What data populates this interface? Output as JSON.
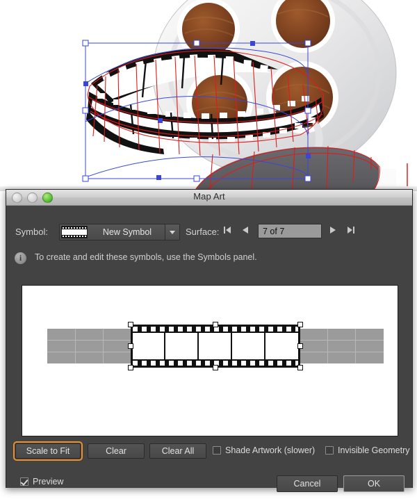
{
  "window": {
    "title": "Map Art",
    "traffic_lights": [
      {
        "name": "close-button",
        "state": "disabled"
      },
      {
        "name": "minimize-button",
        "state": "disabled"
      },
      {
        "name": "zoom-button",
        "state": "enabled",
        "color": "#59c13a"
      }
    ]
  },
  "symbol_row": {
    "label": "Symbol:",
    "selected": "New Symbol",
    "thumbnail_icon": "film-strip-icon",
    "dropdown_icon": "chevron-down-icon"
  },
  "surface_row": {
    "label": "Surface:",
    "value": "7 of 7",
    "first_icon": "first-surface-icon",
    "prev_icon": "previous-surface-icon",
    "next_icon": "next-surface-icon",
    "last_icon": "last-surface-icon"
  },
  "info": {
    "icon": "info-icon",
    "text": "To create and edit these symbols, use the Symbols panel."
  },
  "preview": {
    "surface_fill": "#9b9b9b",
    "canvas_background": "#ffffff",
    "grid_columns": 12,
    "grid_rows": 3,
    "mapped_symbol": "film-strip-icon",
    "symbol_selected": true
  },
  "buttons": {
    "scale_to_fit": "Scale to Fit",
    "clear": "Clear",
    "clear_all": "Clear All",
    "cancel": "Cancel",
    "ok": "OK",
    "focus_ring_color": "#e8902a"
  },
  "checkboxes": {
    "shade_artwork": {
      "label": "Shade Artwork (slower)",
      "checked": false
    },
    "invisible_geometry": {
      "label": "Invisible Geometry",
      "checked": false
    },
    "preview": {
      "label": "Preview",
      "checked": true
    }
  },
  "artwork": {
    "description": "film-reel-3d-revolve",
    "reel_color": "#e9e9ea",
    "hole_color": "#8a4a22",
    "selection_color": "#3a47d6",
    "map_wireframe_color": "#e01b1b",
    "film_black": "#111111",
    "film_shadow": "#5a5a5d",
    "blue_tile_color": "#0fb0ee"
  }
}
